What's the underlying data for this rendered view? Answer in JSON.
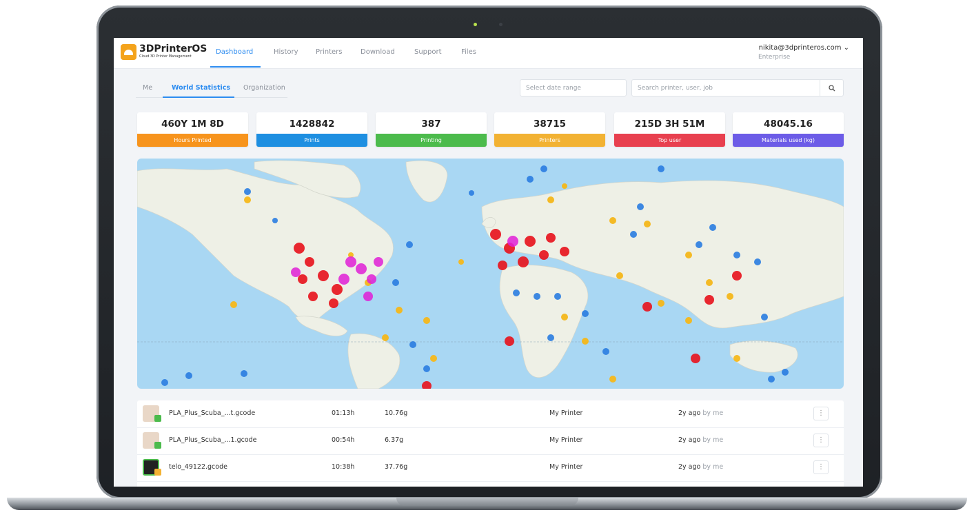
{
  "app": {
    "logo_title": "3DPrinterOS",
    "logo_subtitle": "Cloud 3D Printer Management",
    "nav": [
      "Dashboard",
      "History",
      "Printers",
      "Download",
      "Support",
      "Files"
    ],
    "active_nav": "Dashboard",
    "user_email": "nikita@3dprinteros.com ⌄",
    "user_plan": "Enterprise"
  },
  "tabs": [
    "Me",
    "World Statistics",
    "Organization"
  ],
  "active_tab": "World Statistics",
  "date_range_placeholder": "Select date range",
  "search_placeholder": "Search printer, user, job",
  "stats": [
    {
      "value": "460Y 1M 8D",
      "label": "Hours Printed",
      "color": "#f7941d"
    },
    {
      "value": "1428842",
      "label": "Prints",
      "color": "#1e8fe1"
    },
    {
      "value": "387",
      "label": "Printing",
      "color": "#4cbb4c"
    },
    {
      "value": "38715",
      "label": "Printers",
      "color": "#f2b233"
    },
    {
      "value": "215D 3H 51M",
      "label": "Top user",
      "color": "#e8404f"
    },
    {
      "value": "48045.16",
      "label": "Materials used (kg)",
      "color": "#6c5ce7"
    }
  ],
  "jobs": [
    {
      "name": "PLA_Plus_Scuba_...t.gcode",
      "time": "01:13h",
      "weight": "10.76g",
      "printer": "My Printer",
      "ago": "2y ago",
      "by": "by me",
      "status": "done"
    },
    {
      "name": "PLA_Plus_Scuba_...1.gcode",
      "time": "00:54h",
      "weight": "6.37g",
      "printer": "My Printer",
      "ago": "2y ago",
      "by": "by me",
      "status": "done"
    },
    {
      "name": "telo_49122.gcode",
      "time": "10:38h",
      "weight": "37.76g",
      "printer": "My Printer",
      "ago": "2y ago",
      "by": "by me",
      "status": "warning"
    }
  ],
  "colors": {
    "accent": "#2d8cf0",
    "ocean": "#a9d7f3",
    "land": "#eef0e6"
  }
}
